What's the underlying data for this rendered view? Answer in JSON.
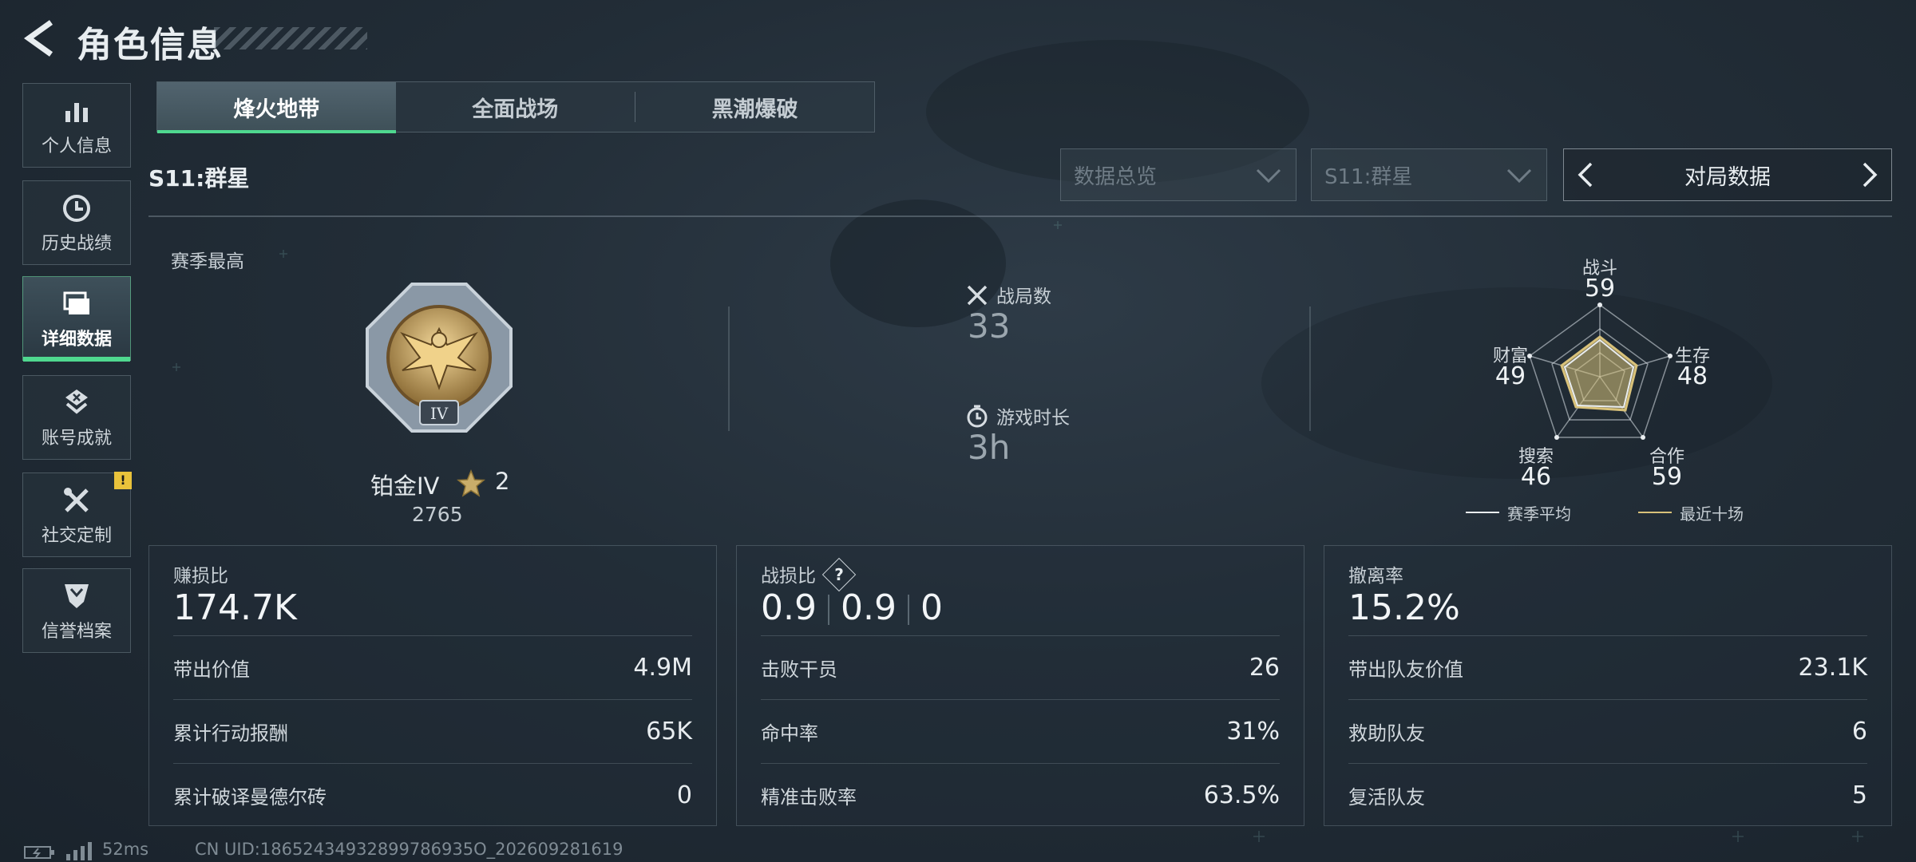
{
  "header": {
    "title": "角色信息"
  },
  "sidebar": {
    "items": [
      {
        "label": "个人信息",
        "icon": "bar-chart-icon"
      },
      {
        "label": "历史战绩",
        "icon": "history-clock-icon"
      },
      {
        "label": "详细数据",
        "icon": "folder-stack-icon",
        "active": true
      },
      {
        "label": "账号成就",
        "icon": "achievement-badge-icon"
      },
      {
        "label": "社交定制",
        "icon": "tools-wrench-icon",
        "alert": "!"
      },
      {
        "label": "信誉档案",
        "icon": "shield-chevron-icon"
      }
    ]
  },
  "tabs": [
    {
      "label": "烽火地带",
      "active": true
    },
    {
      "label": "全面战场"
    },
    {
      "label": "黑潮爆破"
    }
  ],
  "season": {
    "label": "S11:群星"
  },
  "filters": {
    "overview": "数据总览",
    "season": "S11:群星",
    "nav_label": "对局数据"
  },
  "summary": {
    "peak_label": "赛季最高",
    "rank_name": "铂金IV",
    "rank_stars": "2",
    "rank_score": "2765",
    "rank_badge_numeral": "IV",
    "matches_label": "战局数",
    "matches_value": "33",
    "playtime_label": "游戏时长",
    "playtime_value": "3h"
  },
  "radar": {
    "axes": [
      {
        "label": "战斗",
        "value": "59"
      },
      {
        "label": "生存",
        "value": "48"
      },
      {
        "label": "合作",
        "value": "59"
      },
      {
        "label": "搜索",
        "value": "46"
      },
      {
        "label": "财富",
        "value": "49"
      }
    ],
    "legend": [
      {
        "label": "赛季平均",
        "color": "#e9edf0"
      },
      {
        "label": "最近十场",
        "color": "#d9c27a"
      }
    ]
  },
  "cards": [
    {
      "title": "赚损比",
      "main": "174.7K",
      "rows": [
        {
          "k": "带出价值",
          "v": "4.9M"
        },
        {
          "k": "累计行动报酬",
          "v": "65K"
        },
        {
          "k": "累计破译曼德尔砖",
          "v": "0"
        }
      ]
    },
    {
      "title": "战损比",
      "help": "?",
      "main_parts": [
        "0.9",
        "0.9",
        "0"
      ],
      "rows": [
        {
          "k": "击败干员",
          "v": "26"
        },
        {
          "k": "命中率",
          "v": "31%"
        },
        {
          "k": "精准击败率",
          "v": "63.5%"
        }
      ]
    },
    {
      "title": "撤离率",
      "main": "15.2%",
      "rows": [
        {
          "k": "带出队友价值",
          "v": "23.1K"
        },
        {
          "k": "救助队友",
          "v": "6"
        },
        {
          "k": "复活队友",
          "v": "5"
        }
      ]
    }
  ],
  "footer": {
    "ping": "52ms",
    "uid": "CN UID:18652434932899786935O_202609281619"
  }
}
